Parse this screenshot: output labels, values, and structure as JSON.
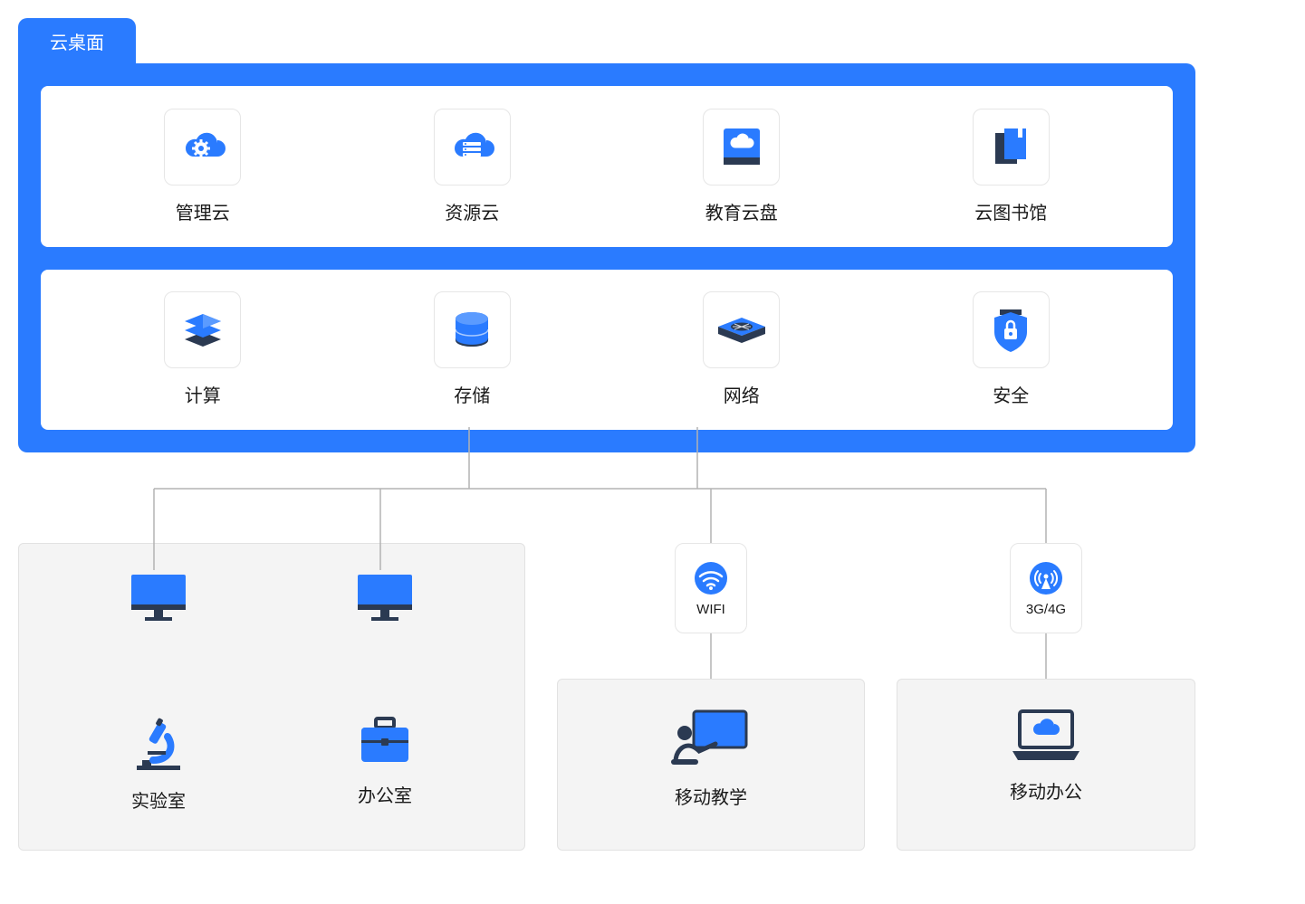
{
  "colors": {
    "accent": "#2a7bff",
    "dark": "#2b3a52",
    "panel": "#f4f4f4"
  },
  "tab": {
    "label": "云桌面"
  },
  "cloud_services": {
    "row1": [
      {
        "id": "management-cloud",
        "label": "管理云",
        "icon": "cloud-gear"
      },
      {
        "id": "resource-cloud",
        "label": "资源云",
        "icon": "cloud-server"
      },
      {
        "id": "edu-cloud-disk",
        "label": "教育云盘",
        "icon": "cloud-disk"
      },
      {
        "id": "cloud-library",
        "label": "云图书馆",
        "icon": "books"
      }
    ],
    "row2": [
      {
        "id": "compute",
        "label": "计算",
        "icon": "compute-stack"
      },
      {
        "id": "storage",
        "label": "存储",
        "icon": "database"
      },
      {
        "id": "network",
        "label": "网络",
        "icon": "router"
      },
      {
        "id": "security",
        "label": "安全",
        "icon": "shield-lock"
      }
    ]
  },
  "network_badges": {
    "wifi": {
      "label": "WIFI",
      "icon": "wifi"
    },
    "cellular": {
      "label": "3G/4G",
      "icon": "cell-tower"
    }
  },
  "endpoints": {
    "lab": {
      "label": "实验室",
      "icon": "microscope"
    },
    "office": {
      "label": "办公室",
      "icon": "briefcase"
    },
    "mobile_teaching": {
      "label": "移动教学",
      "icon": "teacher-board"
    },
    "mobile_office": {
      "label": "移动办公",
      "icon": "cloud-laptop"
    }
  },
  "clients": {
    "lab_monitor": {
      "icon": "monitor"
    },
    "office_monitor": {
      "icon": "monitor"
    }
  }
}
